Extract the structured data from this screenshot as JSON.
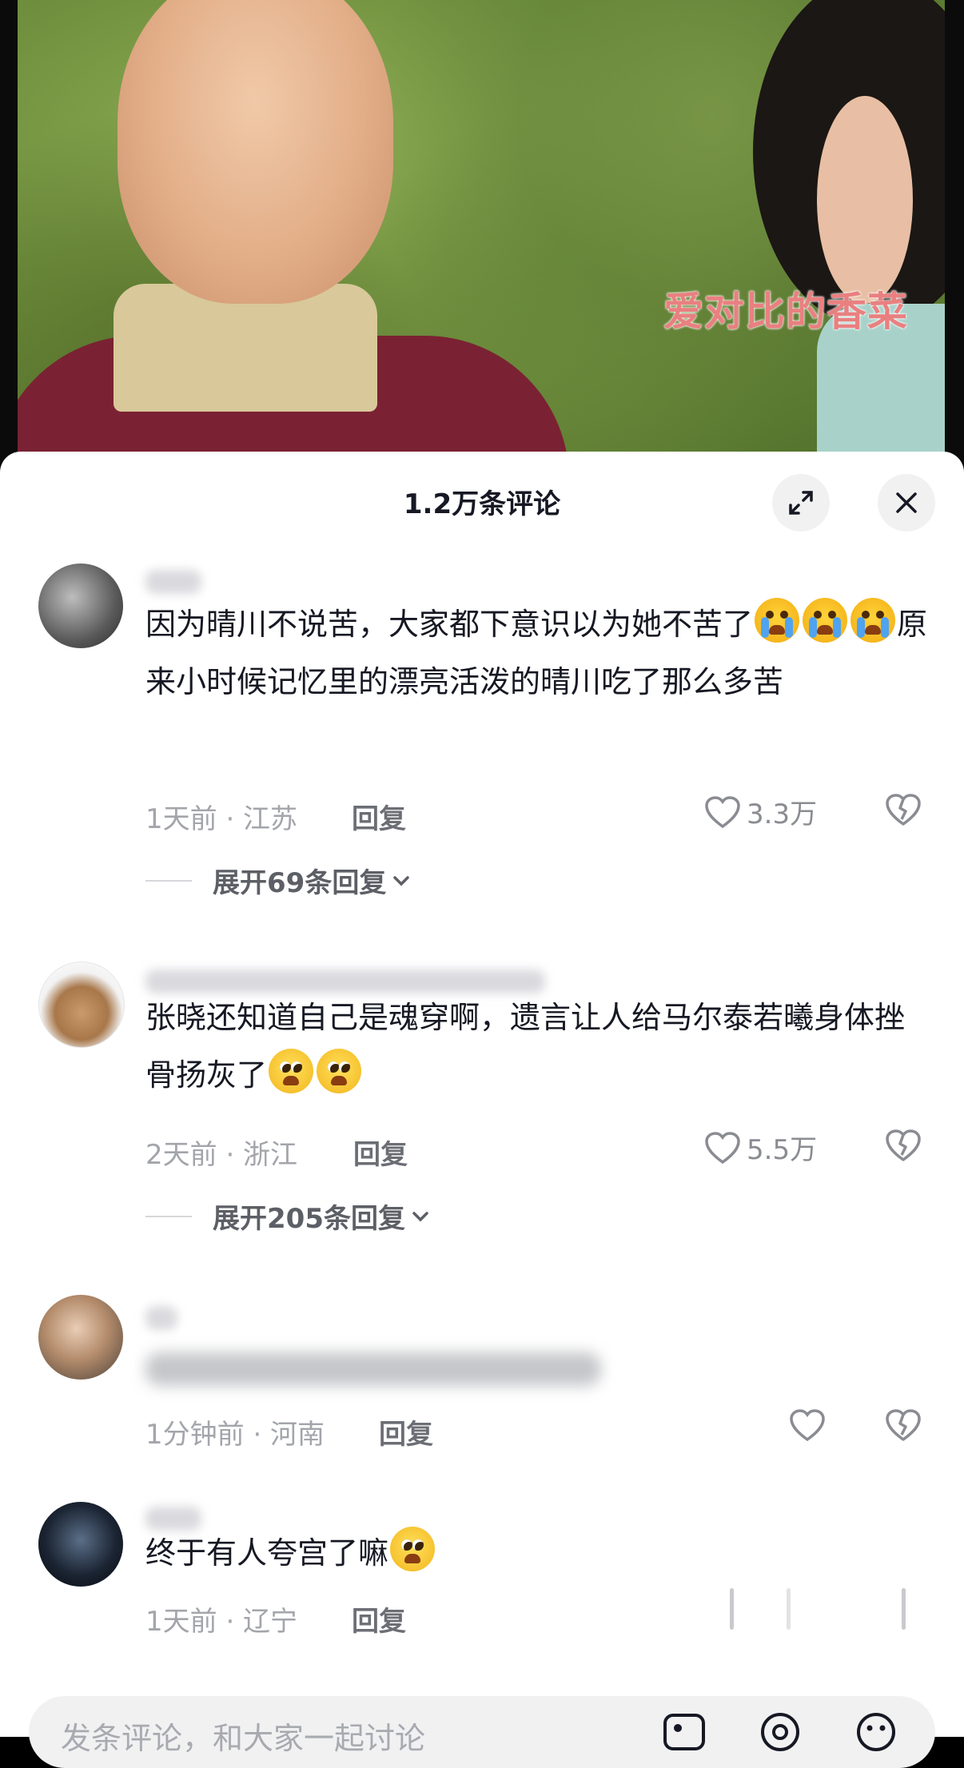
{
  "video": {
    "watermark": "爱对比的香菜"
  },
  "sheet": {
    "title": "1.2万条评论",
    "expand_icon": "expand-icon",
    "close_icon": "close-icon"
  },
  "comments": [
    {
      "text_parts": [
        "因为晴川不说苦，大家都下意识以为她不苦了",
        "原来小时候记忆里的漂亮活泼的晴川吃了那么多苦"
      ],
      "meta": "1天前 · 江苏",
      "reply_label": "回复",
      "likes": "3.3万",
      "expand_label": "展开69条回复"
    },
    {
      "text_parts": [
        "张晓还知道自己是魂穿啊，遗言让人给马尔泰若曦身体挫骨扬灰了"
      ],
      "meta": "2天前 · 浙江",
      "reply_label": "回复",
      "likes": "5.5万",
      "expand_label": "展开205条回复"
    },
    {
      "meta": "1分钟前 · 河南",
      "reply_label": "回复"
    },
    {
      "text_parts": [
        "终于有人夸宫了嘛"
      ],
      "meta": "1天前 · 辽宁",
      "reply_label": "回复"
    }
  ],
  "input": {
    "placeholder": "发条评论，和大家一起讨论"
  },
  "colors": {
    "sheet_bg": "#ffffff",
    "meta_gray": "#a3a5ab",
    "text": "#161823"
  }
}
